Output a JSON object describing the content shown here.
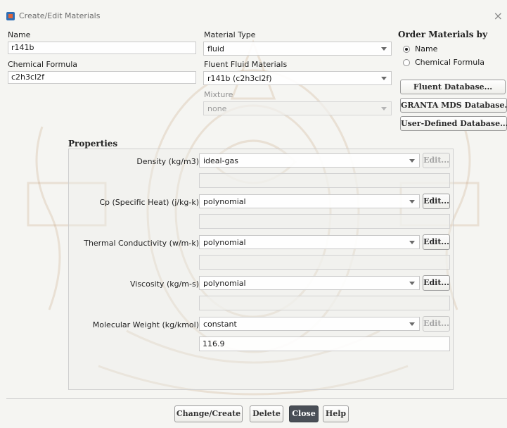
{
  "window": {
    "title": "Create/Edit Materials",
    "close_glyph": "×",
    "icon": "fluent-app-icon"
  },
  "name": {
    "label": "Name",
    "value": "r141b"
  },
  "chemical_formula": {
    "label": "Chemical Formula",
    "value": "c2h3cl2f"
  },
  "material_type": {
    "label": "Material Type",
    "value": "fluid"
  },
  "fluent_materials": {
    "label": "Fluent Fluid Materials",
    "value": "r141b (c2h3cl2f)"
  },
  "mixture": {
    "label": "Mixture",
    "value": "none"
  },
  "order_by": {
    "label": "Order Materials by",
    "options": [
      {
        "label": "Name",
        "selected": true
      },
      {
        "label": "Chemical Formula",
        "selected": false
      }
    ]
  },
  "databases": {
    "fluent": "Fluent Database...",
    "granta": "GRANTA MDS Database...",
    "user": "User-Defined Database..."
  },
  "properties": {
    "title": "Properties",
    "edit_label": "Edit...",
    "rows": [
      {
        "label": "Density (kg/m3)",
        "method": "ideal-gas",
        "value": "",
        "edit_enabled": false
      },
      {
        "label": "Cp (Specific Heat) (j/kg-k)",
        "method": "polynomial",
        "value": "",
        "edit_enabled": true
      },
      {
        "label": "Thermal Conductivity (w/m-k)",
        "method": "polynomial",
        "value": "",
        "edit_enabled": true
      },
      {
        "label": "Viscosity (kg/m-s)",
        "method": "polynomial",
        "value": "",
        "edit_enabled": true
      },
      {
        "label": "Molecular Weight (kg/kmol)",
        "method": "constant",
        "value": "116.9",
        "edit_enabled": false
      }
    ]
  },
  "buttons": {
    "change_create": "Change/Create",
    "delete": "Delete",
    "close": "Close",
    "help": "Help"
  },
  "colors": {
    "primary_button": "#4a4f57",
    "title_text": "#6d6d6d",
    "watermark": "#caa98a"
  }
}
